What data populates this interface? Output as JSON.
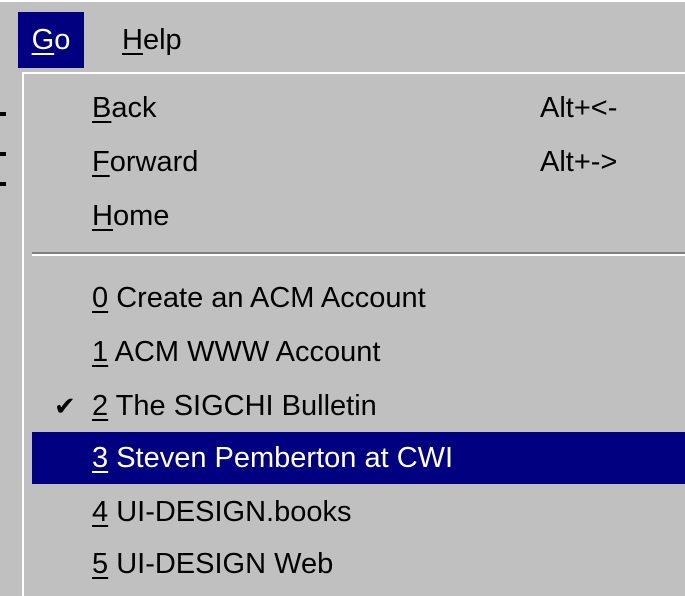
{
  "menubar": {
    "go": {
      "accel": "G",
      "rest": "o"
    },
    "help": {
      "accel": "H",
      "rest": "elp"
    }
  },
  "menu": {
    "nav": [
      {
        "accel": "B",
        "rest": "ack",
        "shortcut": "Alt+<-"
      },
      {
        "accel": "F",
        "rest": "orward",
        "shortcut": "Alt+->"
      },
      {
        "accel": "H",
        "rest": "ome",
        "shortcut": ""
      }
    ],
    "history": [
      {
        "accel": "0",
        "rest": " Create an ACM Account",
        "checked": false,
        "selected": false
      },
      {
        "accel": "1",
        "rest": " ACM WWW Account",
        "checked": false,
        "selected": false
      },
      {
        "accel": "2",
        "rest": " The SIGCHI Bulletin",
        "checked": true,
        "selected": false
      },
      {
        "accel": "3",
        "rest": " Steven Pemberton at CWI",
        "checked": false,
        "selected": true
      },
      {
        "accel": "4",
        "rest": " UI-DESIGN.books",
        "checked": false,
        "selected": false
      },
      {
        "accel": "5",
        "rest": " UI-DESIGN Web",
        "checked": false,
        "selected": false
      }
    ],
    "check_glyph": "✔"
  }
}
